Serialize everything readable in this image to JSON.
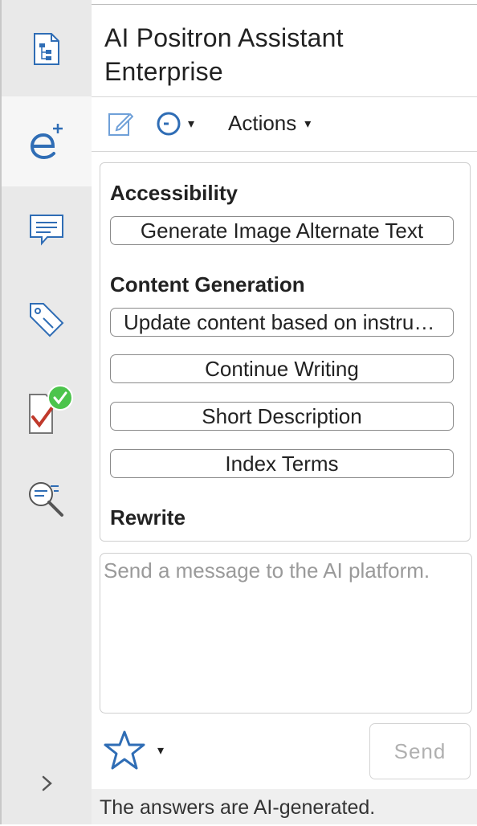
{
  "app": {
    "title_line1": "AI Positron Assistant",
    "title_line2": "Enterprise"
  },
  "sidebar": {
    "items": [
      {
        "icon": "document-outline-icon"
      },
      {
        "icon": "ai-positron-icon",
        "active": true
      },
      {
        "icon": "comment-icon"
      },
      {
        "icon": "tag-icon"
      },
      {
        "icon": "checked-document-icon"
      },
      {
        "icon": "search-text-icon"
      }
    ],
    "expand_icon": "chevron-right-icon"
  },
  "toolbar": {
    "actions_label": "Actions",
    "actions_caret": "▾",
    "history_caret": "▾"
  },
  "sections": [
    {
      "title": "Accessibility",
      "buttons": [
        "Generate Image Alternate Text"
      ]
    },
    {
      "title": "Content Generation",
      "buttons": [
        "Update content based on instructions",
        "Continue Writing",
        "Short Description",
        "Index Terms"
      ]
    },
    {
      "title": "Rewrite",
      "buttons": [
        ""
      ]
    }
  ],
  "message": {
    "placeholder": "Send a message to the AI platform."
  },
  "bottom": {
    "favorites_caret": "▾",
    "send_label": "Send"
  },
  "footer": {
    "text": "The answers are AI-generated."
  },
  "colors": {
    "accent": "#2f6db5",
    "check_green": "#4cc44c",
    "check_red": "#c0392b"
  }
}
